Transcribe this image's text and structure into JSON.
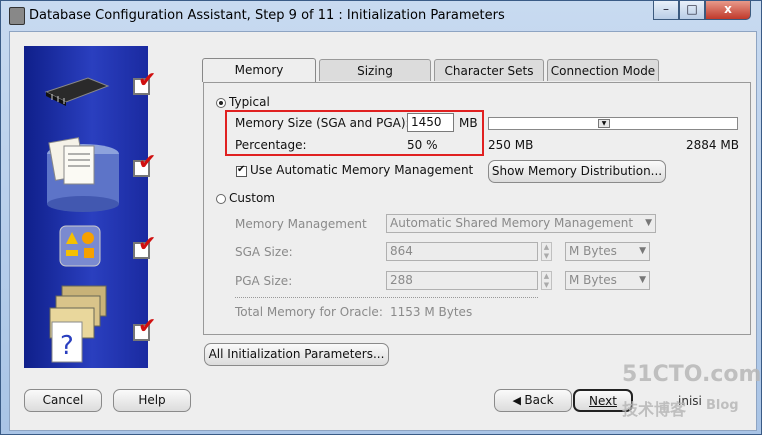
{
  "window": {
    "title": "Database Configuration Assistant, Step 9 of 11 : Initialization Parameters",
    "controls": {
      "minimize": "–",
      "maximize": "□",
      "close": "x"
    }
  },
  "tabs": [
    "Memory",
    "Sizing",
    "Character Sets",
    "Connection Mode"
  ],
  "memory": {
    "typical_label": "Typical",
    "memory_size_label": "Memory Size (SGA and PGA):",
    "memory_size_value": "1450",
    "memory_size_unit": "MB",
    "percentage_label": "Percentage:",
    "percentage_value": "50 %",
    "slider_min": "250 MB",
    "slider_max": "2884 MB",
    "slider_fraction": 0.46,
    "auto_mem_label": "Use Automatic Memory Management",
    "show_dist_button": "Show Memory Distribution...",
    "custom_label": "Custom",
    "mem_mgmt_label": "Memory Management",
    "mem_mgmt_value": "Automatic Shared Memory Management",
    "sga_label": "SGA Size:",
    "sga_value": "864",
    "sga_unit": "M Bytes",
    "pga_label": "PGA Size:",
    "pga_value": "288",
    "pga_unit": "M Bytes",
    "total_label": "Total Memory for Oracle:",
    "total_value": "1153 M Bytes"
  },
  "all_params_button": "All Initialization Parameters...",
  "footer": {
    "cancel": "Cancel",
    "help": "Help",
    "back": "Back",
    "next": "Next",
    "finish_partial": "inisi"
  },
  "watermark": {
    "line1": "51CTO.com",
    "line2": "技术博客",
    "line3": "Blog"
  },
  "colors": {
    "highlight_box": "#e02020",
    "side_panel": "#1a2aa0"
  }
}
